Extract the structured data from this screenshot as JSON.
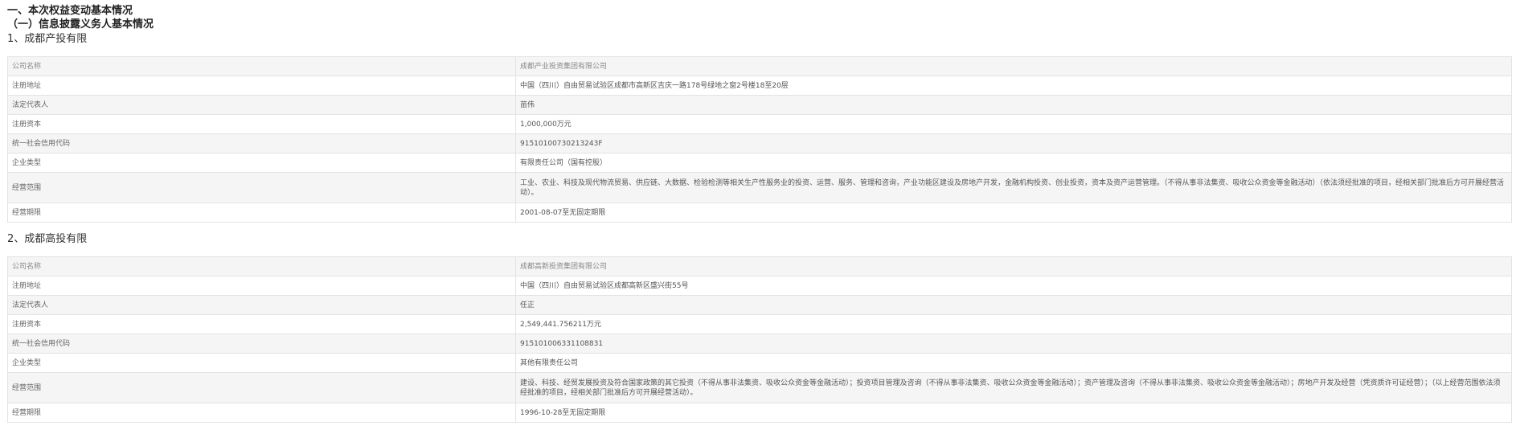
{
  "heading": "一、本次权益变动基本情况",
  "subheading": "（一）信息披露义务人基本情况",
  "sections": [
    {
      "title": "1、成都产投有限",
      "rows": [
        {
          "label": "公司名称",
          "value": "成都产业投资集团有限公司"
        },
        {
          "label": "注册地址",
          "value": "中国（四川）自由贸易试验区成都市高新区吉庆一路178号绿地之窗2号楼18至20层"
        },
        {
          "label": "法定代表人",
          "value": "苗伟"
        },
        {
          "label": "注册资本",
          "value": "1,000,000万元"
        },
        {
          "label": "统一社会信用代码",
          "value": "91510100730213243F"
        },
        {
          "label": "企业类型",
          "value": "有限责任公司（国有控股）"
        },
        {
          "label": "经营范围",
          "value": "工业、农业、科技及现代物流贸易、供应链、大数据、检验检测等相关生产性服务业的投资、运营、服务、管理和咨询，产业功能区建设及房地产开发，金融机构投资、创业投资，资本及资产运营管理。（不得从事非法集资、吸收公众资金等金融活动）（依法须经批准的项目，经相关部门批准后方可开展经营活动）。"
        },
        {
          "label": "经营期限",
          "value": "2001-08-07至无固定期限"
        }
      ]
    },
    {
      "title": "2、成都高投有限",
      "rows": [
        {
          "label": "公司名称",
          "value": "成都高新投资集团有限公司"
        },
        {
          "label": "注册地址",
          "value": "中国（四川）自由贸易试验区成都高新区盛兴街55号"
        },
        {
          "label": "法定代表人",
          "value": "任正"
        },
        {
          "label": "注册资本",
          "value": "2,549,441.756211万元"
        },
        {
          "label": "统一社会信用代码",
          "value": "915101006331108831"
        },
        {
          "label": "企业类型",
          "value": "其他有限责任公司"
        },
        {
          "label": "经营范围",
          "value": "建设、科技、经贸发展投资及符合国家政策的其它投资（不得从事非法集资、吸收公众资金等金融活动）；投资项目管理及咨询（不得从事非法集资、吸收公众资金等金融活动）；资产管理及咨询（不得从事非法集资、吸收公众资金等金融活动）；房地产开发及经营（凭资质许可证经营）；（以上经营范围依法须经批准的项目，经相关部门批准后方可开展经营活动）。"
        },
        {
          "label": "经营期限",
          "value": "1996-10-28至无固定期限"
        }
      ]
    }
  ]
}
